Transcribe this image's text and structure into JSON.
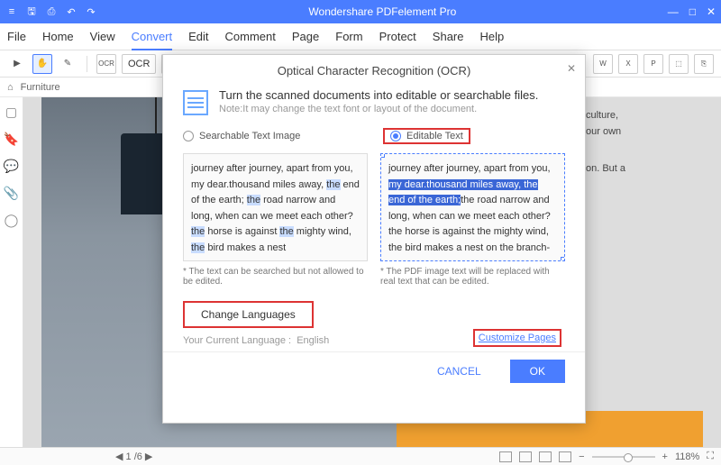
{
  "titlebar": {
    "app": "Wondershare PDFelement Pro"
  },
  "menu": {
    "file": "File",
    "home": "Home",
    "view": "View",
    "convert": "Convert",
    "edit": "Edit",
    "comment": "Comment",
    "page": "Page",
    "form": "Form",
    "protect": "Protect",
    "share": "Share",
    "help": "Help"
  },
  "toolbar": {
    "ocr": "OCR"
  },
  "tabs": {
    "home_icon": "⌂",
    "doc": "Furniture"
  },
  "doc_snippet": {
    "l1": "culture,",
    "l2": "our own",
    "l3": "on. But a"
  },
  "modal": {
    "title": "Optical Character Recognition (OCR)",
    "heading": "Turn the scanned documents into editable or searchable files.",
    "note": "Note:It may change the text font or layout of the document.",
    "opt_search": "Searchable Text Image",
    "opt_edit": "Editable Text",
    "preview_search": "journey after journey, apart from you, my dear.thousand miles away, the end of the earth; the road narrow and long, when can we meet each other? the horse is against the mighty wind, the bird makes a nest",
    "preview_edit": {
      "l1": "journey after journey, apart from you,",
      "l2": "my dear.thousand miles away, the",
      "l3": "end of the earth;",
      "l3b": "the road narrow and",
      "l4": "long, when can we meet each other?",
      "l5": "the horse is against the mighty wind,",
      "l6": "the bird makes a nest on the branch-"
    },
    "note_search": "* The text can be searched but not allowed to be edited.",
    "note_edit": "* The PDF image text will be replaced with real text that can be edited.",
    "change_lang": "Change Languages",
    "cur_lang_label": "Your Current Language :",
    "cur_lang": "English",
    "customize": "Customize Pages",
    "cancel": "CANCEL",
    "ok": "OK"
  },
  "status": {
    "page": "1 /6",
    "zoom": "118%"
  }
}
